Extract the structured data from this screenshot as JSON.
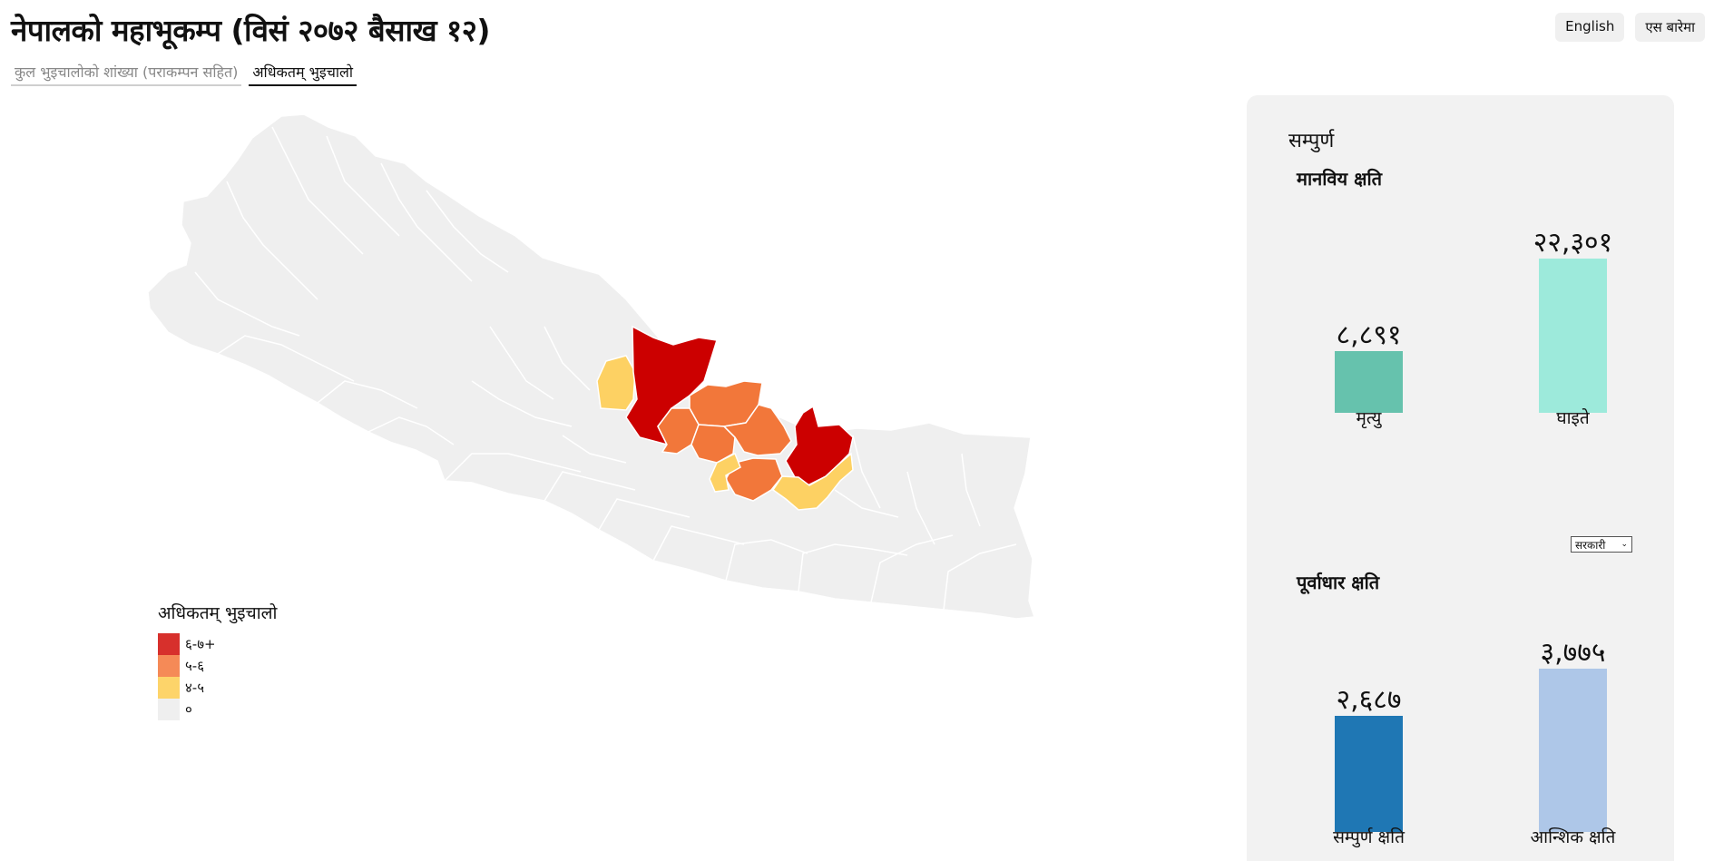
{
  "header": {
    "title": "नेपालको महाभूकम्प (विसं २०७२ बैसाख १२)",
    "buttons": {
      "english": "English",
      "about": "एस बारेमा"
    }
  },
  "tabs": [
    {
      "label": "कुल भुइचालोको शांख्या (पराकम्पन सहित)",
      "active": false
    },
    {
      "label": "अधिकतम् भुइचालो",
      "active": true
    }
  ],
  "legend": {
    "title": "अधिकतम् भुइचालो",
    "items": [
      {
        "label": "६-७+",
        "color": "#d7302c"
      },
      {
        "label": "५-६",
        "color": "#f58a57"
      },
      {
        "label": "४-५",
        "color": "#fdd46a"
      },
      {
        "label": "०",
        "color": "#efefef"
      }
    ]
  },
  "map_colors": {
    "base": "#efefef",
    "red": "#cc0000",
    "orange": "#f2773a",
    "yellow": "#fdd163"
  },
  "panel": {
    "title": "सम्पुर्ण",
    "human_title": "मानविय क्षति",
    "infra_title": "पूर्वाधार क्षति",
    "select_value": "सरकारी"
  },
  "chart_data": [
    {
      "type": "bar",
      "title": "मानविय क्षति",
      "categories": [
        "मृत्यु",
        "घाइते"
      ],
      "values": [
        8891,
        22301
      ],
      "value_labels": [
        "८,८९१",
        "२२,३०१"
      ],
      "colors": [
        "#66c2ad",
        "#9deadb"
      ]
    },
    {
      "type": "bar",
      "title": "पूर्वाधार क्षति",
      "categories": [
        "सम्पुर्ण क्षति",
        "आन्शिक क्षति"
      ],
      "values": [
        2687,
        3775
      ],
      "value_labels": [
        "२,६८७",
        "३,७७५"
      ],
      "colors": [
        "#1f77b4",
        "#aec7e8"
      ]
    }
  ]
}
